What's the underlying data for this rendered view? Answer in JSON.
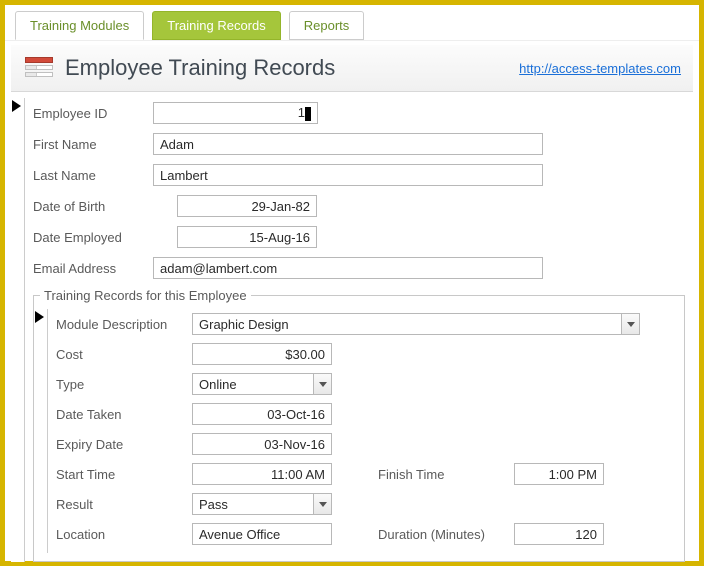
{
  "tabs": {
    "modules": "Training Modules",
    "records": "Training Records",
    "reports": "Reports"
  },
  "header": {
    "title": "Employee Training Records",
    "link": "http://access-templates.com"
  },
  "employee": {
    "labels": {
      "id": "Employee ID",
      "first": "First Name",
      "last": "Last Name",
      "dob": "Date of Birth",
      "employed": "Date Employed",
      "email": "Email Address"
    },
    "values": {
      "id": "1",
      "first": "Adam",
      "last": "Lambert",
      "dob": "29-Jan-82",
      "employed": "15-Aug-16",
      "email": "adam@lambert.com"
    }
  },
  "subform": {
    "legend": "Training Records for this Employee",
    "labels": {
      "module": "Module Description",
      "cost": "Cost",
      "type": "Type",
      "taken": "Date Taken",
      "expiry": "Expiry Date",
      "start": "Start Time",
      "finish": "Finish Time",
      "result": "Result",
      "location": "Location",
      "duration": "Duration (Minutes)"
    },
    "values": {
      "module": "Graphic Design",
      "cost": "$30.00",
      "type": "Online",
      "taken": "03-Oct-16",
      "expiry": "03-Nov-16",
      "start": "11:00 AM",
      "finish": "1:00 PM",
      "result": "Pass",
      "location": "Avenue Office",
      "duration": "120"
    }
  }
}
